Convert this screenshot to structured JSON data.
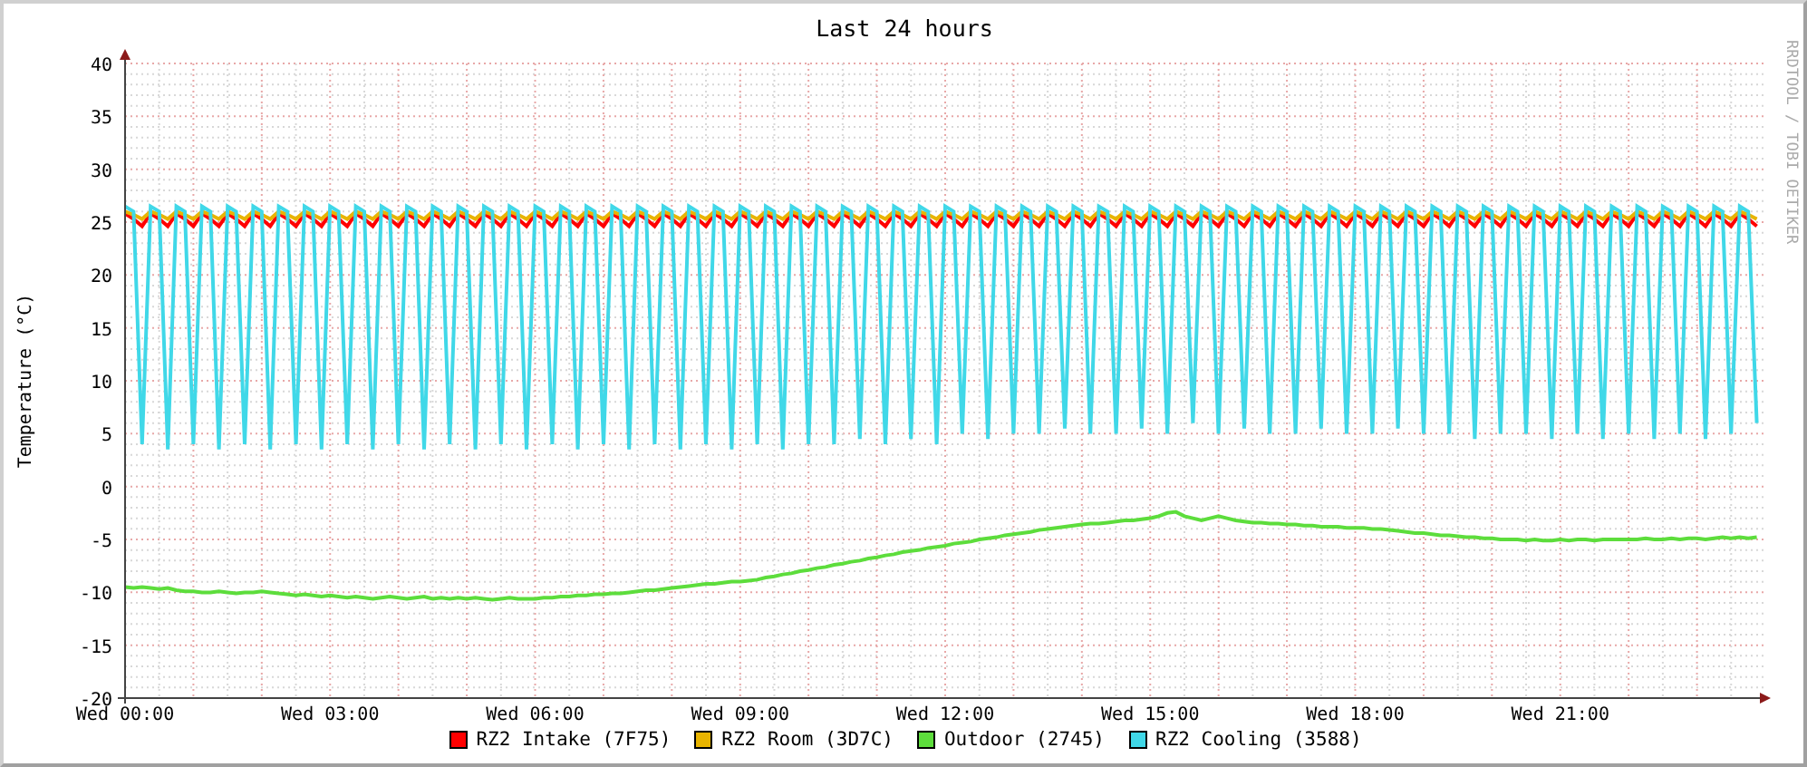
{
  "title": "Last 24 hours",
  "credit": "RRDTOOL / TOBI OETIKER",
  "chart_data": {
    "type": "line",
    "grid": true,
    "ylabel": "Temperature (°C)",
    "ylim": [
      -20,
      40
    ],
    "yticks": [
      -20,
      -15,
      -10,
      -5,
      0,
      5,
      10,
      15,
      20,
      25,
      30,
      35,
      40
    ],
    "categories": [
      "Wed 00:00",
      null,
      null,
      null,
      null,
      null,
      null,
      null,
      null,
      null,
      null,
      null,
      null,
      null,
      null,
      null,
      null,
      null,
      null,
      null,
      null,
      null,
      null,
      null,
      "Wed 03:00",
      null,
      null,
      null,
      null,
      null,
      null,
      null,
      null,
      null,
      null,
      null,
      null,
      null,
      null,
      null,
      null,
      null,
      null,
      null,
      null,
      null,
      null,
      null,
      "Wed 06:00",
      null,
      null,
      null,
      null,
      null,
      null,
      null,
      null,
      null,
      null,
      null,
      null,
      null,
      null,
      null,
      null,
      null,
      null,
      null,
      null,
      null,
      null,
      null,
      "Wed 09:00",
      null,
      null,
      null,
      null,
      null,
      null,
      null,
      null,
      null,
      null,
      null,
      null,
      null,
      null,
      null,
      null,
      null,
      null,
      null,
      null,
      null,
      null,
      null,
      "Wed 12:00",
      null,
      null,
      null,
      null,
      null,
      null,
      null,
      null,
      null,
      null,
      null,
      null,
      null,
      null,
      null,
      null,
      null,
      null,
      null,
      null,
      null,
      null,
      null,
      "Wed 15:00",
      null,
      null,
      null,
      null,
      null,
      null,
      null,
      null,
      null,
      null,
      null,
      null,
      null,
      null,
      null,
      null,
      null,
      null,
      null,
      null,
      null,
      null,
      null,
      "Wed 18:00",
      null,
      null,
      null,
      null,
      null,
      null,
      null,
      null,
      null,
      null,
      null,
      null,
      null,
      null,
      null,
      null,
      null,
      null,
      null,
      null,
      null,
      null,
      null,
      "Wed 21:00",
      null,
      null,
      null,
      null,
      null,
      null,
      null,
      null,
      null,
      null,
      null,
      null,
      null,
      null,
      null,
      null,
      null,
      null,
      null,
      null,
      null,
      null,
      null
    ],
    "series": [
      {
        "name": "RZ2 Intake (7F75)",
        "color": "#ff0000",
        "values": [
          25.8,
          25.3,
          24.6,
          25.8,
          25.3,
          24.6,
          25.8,
          25.3,
          24.6,
          25.8,
          25.3,
          24.6,
          25.8,
          25.3,
          24.6,
          25.8,
          25.3,
          24.6,
          25.8,
          25.3,
          24.6,
          25.8,
          25.3,
          24.6,
          25.8,
          25.3,
          24.6,
          25.8,
          25.3,
          24.6,
          25.8,
          25.3,
          24.6,
          25.8,
          25.3,
          24.6,
          25.8,
          25.3,
          24.6,
          25.8,
          25.3,
          24.6,
          25.8,
          25.3,
          24.6,
          25.8,
          25.3,
          24.6,
          25.8,
          25.3,
          24.6,
          25.8,
          25.3,
          24.6,
          25.8,
          25.3,
          24.6,
          25.8,
          25.3,
          24.6,
          25.8,
          25.3,
          24.6,
          25.8,
          25.3,
          24.6,
          25.8,
          25.3,
          24.6,
          25.8,
          25.3,
          24.6,
          25.8,
          25.3,
          24.6,
          25.8,
          25.3,
          24.6,
          25.8,
          25.3,
          24.6,
          25.8,
          25.3,
          24.6,
          25.8,
          25.3,
          24.6,
          25.8,
          25.3,
          24.6,
          25.8,
          25.3,
          24.6,
          25.8,
          25.3,
          24.6,
          25.8,
          25.3,
          24.6,
          25.8,
          25.3,
          24.6,
          25.8,
          25.3,
          24.6,
          25.8,
          25.3,
          24.6,
          25.8,
          25.3,
          24.6,
          25.8,
          25.3,
          24.6,
          25.8,
          25.3,
          24.6,
          25.8,
          25.3,
          24.6,
          25.8,
          25.3,
          24.6,
          25.8,
          25.3,
          24.6,
          25.8,
          25.3,
          24.6,
          25.8,
          25.3,
          24.6,
          25.8,
          25.3,
          24.6,
          25.8,
          25.3,
          24.6,
          25.8,
          25.3,
          24.6,
          25.8,
          25.3,
          24.6,
          25.8,
          25.3,
          24.6,
          25.8,
          25.3,
          24.6,
          25.8,
          25.3,
          24.6,
          25.8,
          25.3,
          24.6,
          25.8,
          25.3,
          24.6,
          25.8,
          25.3,
          24.6,
          25.8,
          25.3,
          24.6,
          25.8,
          25.3,
          24.6,
          25.8,
          25.3,
          24.6,
          25.8,
          25.3,
          24.6,
          25.8,
          25.3,
          24.6,
          25.8,
          25.3,
          24.6,
          25.8,
          25.3,
          24.6,
          25.8,
          25.3,
          24.6,
          25.8,
          25.3,
          24.6,
          25.8,
          25.3,
          24.6
        ]
      },
      {
        "name": "RZ2 Room (3D7C)",
        "color": "#e8b400",
        "values": [
          26,
          25.7,
          25.3,
          26,
          25.7,
          25.3,
          26,
          25.7,
          25.3,
          26,
          25.7,
          25.3,
          26,
          25.7,
          25.3,
          26,
          25.7,
          25.3,
          26,
          25.7,
          25.3,
          26,
          25.7,
          25.3,
          26,
          25.7,
          25.3,
          26,
          25.7,
          25.3,
          26,
          25.7,
          25.3,
          26,
          25.7,
          25.3,
          26,
          25.7,
          25.3,
          26,
          25.7,
          25.3,
          26,
          25.7,
          25.3,
          26,
          25.7,
          25.3,
          26,
          25.7,
          25.3,
          26,
          25.7,
          25.3,
          26,
          25.7,
          25.3,
          26,
          25.7,
          25.3,
          26,
          25.7,
          25.3,
          26,
          25.7,
          25.3,
          26,
          25.7,
          25.3,
          26,
          25.7,
          25.3,
          26,
          25.7,
          25.3,
          26,
          25.7,
          25.3,
          26,
          25.7,
          25.3,
          26,
          25.7,
          25.3,
          26,
          25.7,
          25.3,
          26,
          25.7,
          25.3,
          26,
          25.7,
          25.3,
          26,
          25.7,
          25.3,
          26,
          25.7,
          25.3,
          26,
          25.7,
          25.3,
          26,
          25.7,
          25.3,
          26,
          25.7,
          25.3,
          26,
          25.7,
          25.3,
          26,
          25.7,
          25.3,
          26,
          25.7,
          25.3,
          26,
          25.7,
          25.3,
          26,
          25.7,
          25.3,
          26,
          25.7,
          25.3,
          26,
          25.7,
          25.3,
          26,
          25.7,
          25.3,
          26,
          25.7,
          25.3,
          26,
          25.7,
          25.3,
          26,
          25.7,
          25.3,
          26,
          25.7,
          25.3,
          26,
          25.7,
          25.3,
          26,
          25.7,
          25.3,
          26,
          25.7,
          25.3,
          26,
          25.7,
          25.3,
          26,
          25.7,
          25.3,
          26,
          25.7,
          25.3,
          26,
          25.7,
          25.3,
          26,
          25.7,
          25.3,
          26,
          25.7,
          25.3,
          26,
          25.7,
          25.3,
          26,
          25.7,
          25.3,
          26,
          25.7,
          25.3,
          26,
          25.7,
          25.3,
          26,
          25.7,
          25.3,
          26,
          25.7,
          25.3,
          26,
          25.7,
          25.3
        ]
      },
      {
        "name": "Outdoor (2745)",
        "color": "#5ddd3c",
        "values": [
          -9.5,
          -9.6,
          -9.5,
          -9.6,
          -9.7,
          -9.6,
          -9.8,
          -9.9,
          -9.9,
          -10,
          -10,
          -9.9,
          -10,
          -10.1,
          -10,
          -10,
          -9.9,
          -10,
          -10.1,
          -10.2,
          -10.3,
          -10.2,
          -10.3,
          -10.4,
          -10.3,
          -10.4,
          -10.5,
          -10.4,
          -10.5,
          -10.6,
          -10.5,
          -10.4,
          -10.5,
          -10.6,
          -10.5,
          -10.4,
          -10.6,
          -10.5,
          -10.6,
          -10.5,
          -10.6,
          -10.5,
          -10.6,
          -10.7,
          -10.6,
          -10.5,
          -10.6,
          -10.6,
          -10.6,
          -10.5,
          -10.5,
          -10.4,
          -10.4,
          -10.3,
          -10.3,
          -10.2,
          -10.2,
          -10.1,
          -10.1,
          -10,
          -9.9,
          -9.8,
          -9.8,
          -9.7,
          -9.6,
          -9.5,
          -9.4,
          -9.3,
          -9.2,
          -9.2,
          -9.1,
          -9,
          -9,
          -8.9,
          -8.8,
          -8.6,
          -8.5,
          -8.3,
          -8.2,
          -8,
          -7.9,
          -7.7,
          -7.6,
          -7.4,
          -7.3,
          -7.1,
          -7,
          -6.8,
          -6.7,
          -6.5,
          -6.4,
          -6.2,
          -6.1,
          -6,
          -5.8,
          -5.7,
          -5.6,
          -5.4,
          -5.3,
          -5.2,
          -5,
          -4.9,
          -4.8,
          -4.6,
          -4.5,
          -4.4,
          -4.3,
          -4.1,
          -4,
          -3.9,
          -3.8,
          -3.7,
          -3.6,
          -3.5,
          -3.5,
          -3.4,
          -3.3,
          -3.2,
          -3.2,
          -3.1,
          -3,
          -2.8,
          -2.5,
          -2.4,
          -2.8,
          -3,
          -3.2,
          -3,
          -2.8,
          -3,
          -3.2,
          -3.3,
          -3.4,
          -3.4,
          -3.5,
          -3.5,
          -3.6,
          -3.6,
          -3.7,
          -3.7,
          -3.8,
          -3.8,
          -3.8,
          -3.9,
          -3.9,
          -3.9,
          -4,
          -4,
          -4.1,
          -4.2,
          -4.3,
          -4.4,
          -4.4,
          -4.5,
          -4.6,
          -4.6,
          -4.7,
          -4.8,
          -4.8,
          -4.9,
          -4.9,
          -5,
          -5,
          -5,
          -5.1,
          -5,
          -5.1,
          -5.1,
          -5,
          -5.1,
          -5,
          -5,
          -5.1,
          -5,
          -5,
          -5,
          -5,
          -5,
          -4.9,
          -5,
          -5,
          -4.9,
          -5,
          -4.9,
          -4.9,
          -5,
          -4.9,
          -4.8,
          -4.9,
          -4.8,
          -4.9,
          -4.8
        ]
      },
      {
        "name": "RZ2 Cooling (3588)",
        "color": "#40d8e8",
        "values": [
          26.5,
          26,
          4,
          26.5,
          26,
          3.5,
          26.5,
          26,
          4,
          26.5,
          26,
          3.5,
          26.5,
          26,
          4,
          26.5,
          26,
          3.5,
          26.5,
          26,
          4,
          26.5,
          26,
          3.5,
          26.5,
          26,
          4,
          26.5,
          26,
          3.5,
          26.5,
          26,
          4,
          26.5,
          26,
          3.5,
          26.5,
          26,
          4,
          26.5,
          26,
          3.5,
          26.5,
          26,
          4,
          26.5,
          26,
          3.5,
          26.5,
          26,
          4,
          26.5,
          26,
          3.5,
          26.5,
          26,
          4,
          26.5,
          26,
          3.5,
          26.5,
          26,
          4,
          26.5,
          26,
          3.5,
          26.5,
          26,
          4,
          26.5,
          26,
          3.5,
          26.5,
          26,
          4,
          26.5,
          26,
          3.5,
          26.5,
          26,
          4,
          26.5,
          26,
          4,
          26.5,
          26,
          4.5,
          26.5,
          26,
          4,
          26.5,
          26,
          4.5,
          26.5,
          26,
          4,
          26.5,
          26,
          5,
          26.5,
          26,
          4.5,
          26.5,
          26,
          5,
          26.5,
          26,
          5,
          26.5,
          26,
          5.5,
          26.5,
          26,
          5,
          26.5,
          26,
          5,
          26.5,
          26,
          5.5,
          26.5,
          26,
          5,
          26.5,
          26,
          6,
          26.5,
          26,
          5,
          26.5,
          26,
          5.5,
          26.5,
          26,
          5,
          26.5,
          26,
          5,
          26.5,
          26,
          5.5,
          26.5,
          26,
          5,
          26.5,
          26,
          5,
          26.5,
          26,
          5.5,
          26.5,
          26,
          5,
          26.5,
          26,
          5,
          26.5,
          26,
          4.5,
          26.5,
          26,
          5,
          26.5,
          26,
          5,
          26.5,
          26,
          4.5,
          26.5,
          26,
          5,
          26.5,
          26,
          4.5,
          26.5,
          26,
          5,
          26.5,
          26,
          4.5,
          26.5,
          26,
          5,
          26.5,
          26,
          4.5,
          26.5,
          26,
          5,
          26.5,
          26,
          6
        ]
      }
    ]
  }
}
